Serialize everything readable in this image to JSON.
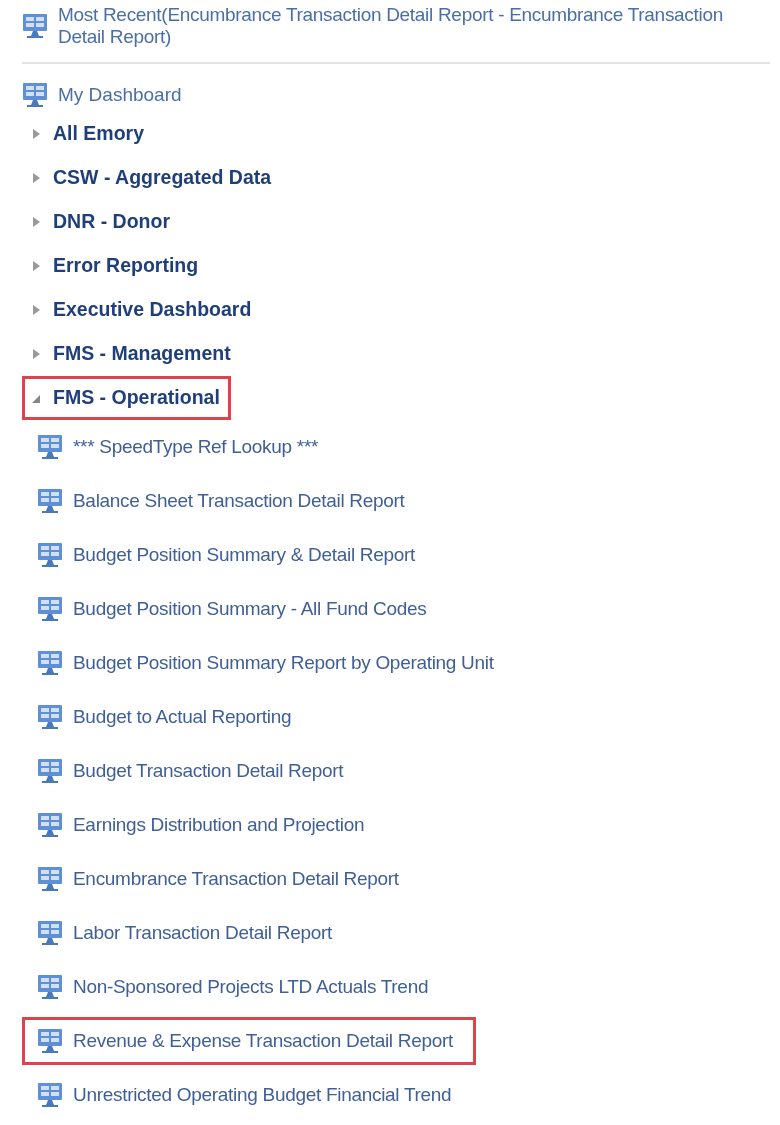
{
  "most_recent": {
    "label": "Most Recent(Encumbrance Transaction Detail Report - Encumbrance Transaction Detail Report)"
  },
  "dashboard": {
    "label": "My Dashboard"
  },
  "folders": [
    {
      "label": "All Emory",
      "expanded": false,
      "highlighted": false
    },
    {
      "label": "CSW - Aggregated Data",
      "expanded": false,
      "highlighted": false
    },
    {
      "label": "DNR - Donor",
      "expanded": false,
      "highlighted": false
    },
    {
      "label": "Error Reporting",
      "expanded": false,
      "highlighted": false
    },
    {
      "label": "Executive Dashboard",
      "expanded": false,
      "highlighted": false
    },
    {
      "label": "FMS - Management",
      "expanded": false,
      "highlighted": false
    },
    {
      "label": "FMS - Operational",
      "expanded": true,
      "highlighted": true,
      "children": [
        {
          "label": "*** SpeedType Ref Lookup ***",
          "highlighted": false
        },
        {
          "label": "Balance Sheet Transaction Detail Report",
          "highlighted": false
        },
        {
          "label": "Budget Position Summary & Detail Report",
          "highlighted": false
        },
        {
          "label": "Budget Position Summary - All Fund Codes",
          "highlighted": false
        },
        {
          "label": "Budget Position Summary Report by Operating Unit",
          "highlighted": false
        },
        {
          "label": "Budget to Actual Reporting",
          "highlighted": false
        },
        {
          "label": "Budget Transaction Detail Report",
          "highlighted": false
        },
        {
          "label": "Earnings Distribution and Projection",
          "highlighted": false
        },
        {
          "label": "Encumbrance Transaction Detail Report",
          "highlighted": false
        },
        {
          "label": "Labor Transaction Detail Report",
          "highlighted": false
        },
        {
          "label": "Non-Sponsored Projects LTD Actuals Trend",
          "highlighted": false
        },
        {
          "label": "Revenue & Expense Transaction Detail Report",
          "highlighted": true
        },
        {
          "label": "Unrestricted Operating Budget Financial Trend",
          "highlighted": false
        }
      ]
    }
  ]
}
